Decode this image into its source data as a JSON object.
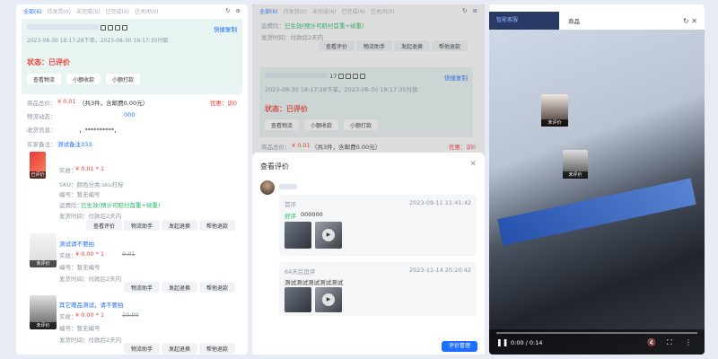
{
  "left": {
    "tabs": [
      "全部(6)",
      "待发货(0)",
      "未完成(6)",
      "已完成(6)",
      "已关闭(0)"
    ],
    "times": "2023-08-30 18:17:28下单，2023-08-30 18:17:35付款",
    "quick_copy": "快捷复制",
    "status": "状态：已评价",
    "buttons": [
      "查看物流",
      "小额收款",
      "小额打款"
    ],
    "total_label": "商品总价：",
    "total_value": "¥ 0.01",
    "total_detail": "（共3件，含邮费0.00元）",
    "discount": "优惠：训0",
    "logistics_label": "物流动态：",
    "logistics_value": "000",
    "address_label": "收货信息：",
    "address_value": "，**********，",
    "remark_label": "买家备注：",
    "remark_value": "测试备注333",
    "items": [
      {
        "badge": "已评价",
        "paid": "实收：",
        "price": "¥ 0.01 * 1",
        "sku": "SKU：颜色分类:sku打标",
        "code": "编号：暂无编号",
        "ship_label": "运费险：",
        "ship_value": "已生效(预计可赔付首重+续重)",
        "send": "发货时间：付款后2天内",
        "actions": [
          "查看评价",
          "物流助手",
          "发起退换",
          "帮他退款"
        ]
      },
      {
        "badge": "未评价",
        "title": "测试请不要拍",
        "paid": "实收：",
        "price": "¥ 0.00 * 1",
        "orig": "0.01",
        "code": "编号：暂无编号",
        "send": "发货时间：付款后2天内",
        "actions": [
          "物流助手",
          "发起退换",
          "帮他退款"
        ]
      },
      {
        "badge": "未评价",
        "title": "其它赠品测试，请不要拍",
        "paid": "实收：",
        "price": "¥ 0.00 * 1",
        "orig": "10.00",
        "code": "编号：暂无编号",
        "send": "发货时间：付款后2天内",
        "actions": [
          "物流助手",
          "发起退换",
          "帮他退款"
        ]
      }
    ]
  },
  "middle": {
    "tabs": [
      "全部(6)",
      "待发货(0)",
      "未完成(6)",
      "已完成(6)",
      "已关闭(0)"
    ],
    "ship_label": "运费险：",
    "ship_value": "已生效(预计可赔付首重+续重)",
    "send": "发货时间：付款后2天内",
    "top_actions": [
      "查看评价",
      "物流助手",
      "发起退换",
      "帮他退款"
    ],
    "order_no_suffix": "17",
    "quick_copy": "快捷复制",
    "times": "2023-08-30 18:17:28下单，2023-08-30 18:17:35付款",
    "status": "状态：已评价",
    "buttons": [
      "查看物流",
      "小额收款",
      "小额打款"
    ],
    "total_label": "商品总价：",
    "total_value": "¥ 0.01",
    "total_detail": "（共3件，含邮费0.00元）",
    "discount": "优惠：训0"
  },
  "dialog": {
    "title": "查看评价",
    "first_label": "首评",
    "first_time": "2023-09-11 11:41:42",
    "first_tag": "好评",
    "first_text": "000000",
    "second_label": "64天后追评",
    "second_time": "2023-11-14 20:20:42",
    "second_text": "测试测试测试测试测试",
    "manage_button": "评价管理"
  },
  "right": {
    "tabs": [
      "智能客服",
      "商品"
    ],
    "video_time": "0:00 / 0:14",
    "screen_badges": [
      "未评价",
      "未评价"
    ]
  },
  "colors": {
    "accent": "#1e6fff",
    "price": "#f04134",
    "positive": "#25b864"
  }
}
